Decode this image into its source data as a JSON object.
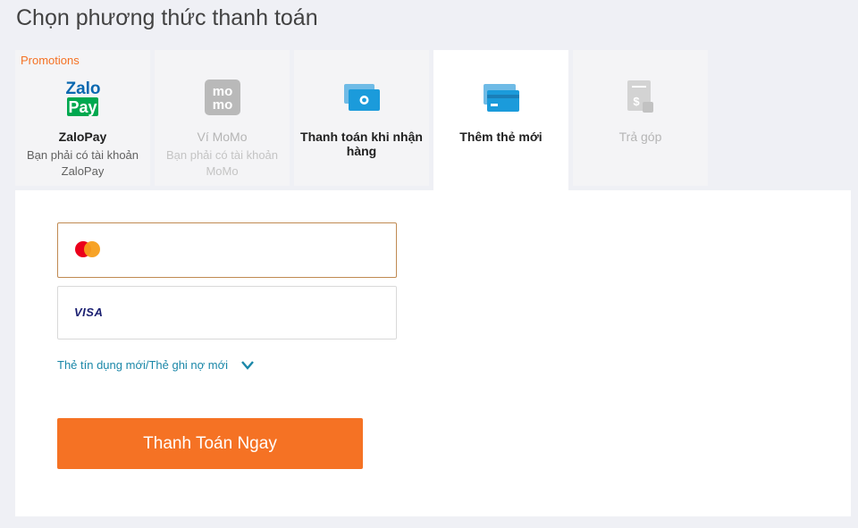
{
  "page": {
    "title": "Chọn phương thức thanh toán"
  },
  "tabs": [
    {
      "promo": "Promotions",
      "name": "ZaloPay",
      "sub": "Bạn phải có tài khoản ZaloPay",
      "icon": "zalopay-icon"
    },
    {
      "name": "Ví MoMo",
      "sub": "Bạn phải có tài khoản MoMo",
      "icon": "momo-icon",
      "disabled": true
    },
    {
      "name": "Thanh toán khi nhận hàng",
      "icon": "cash-on-delivery-icon"
    },
    {
      "name": "Thêm thẻ mới",
      "icon": "credit-card-icon",
      "active": true
    },
    {
      "name": "Trả góp",
      "icon": "installment-icon",
      "disabled": true
    }
  ],
  "icons": {
    "zalo_top": "Zalo",
    "zalo_bottom": "Pay",
    "momo_top": "mo",
    "momo_bottom": "mo"
  },
  "cards": [
    {
      "brand": "mastercard",
      "selected": true
    },
    {
      "brand": "visa",
      "label": "VISA"
    }
  ],
  "new_card_link": "Thẻ tín dụng mới/Thẻ ghi nợ mới",
  "pay_button": "Thanh Toán Ngay",
  "colors": {
    "accent": "#f57224",
    "link": "#1a87a8",
    "background": "#eff0f5",
    "promo": "#f57224"
  }
}
